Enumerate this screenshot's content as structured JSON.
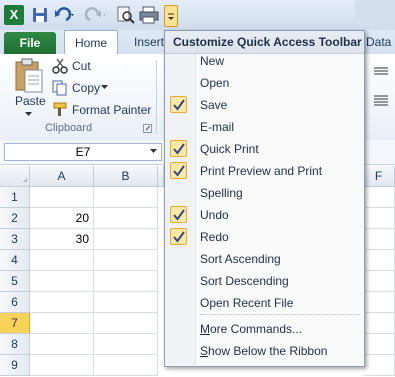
{
  "titlebar": {
    "excel_logo": "X"
  },
  "ribbon": {
    "tabs": [
      "File",
      "Home",
      "Insert",
      "Data"
    ],
    "clipboard": {
      "paste": "Paste",
      "cut": "Cut",
      "copy": "Copy",
      "format_painter": "Format Painter",
      "group_label": "Clipboard"
    }
  },
  "formula_bar": {
    "name_box": "E7"
  },
  "sheet": {
    "columns": [
      "A",
      "B",
      "F"
    ],
    "rows": [
      "1",
      "2",
      "3",
      "4",
      "5",
      "6",
      "7",
      "8",
      "9"
    ],
    "active_row": "7",
    "cells": {
      "a2": "20",
      "a3": "30"
    }
  },
  "menu": {
    "title": "Customize Quick Access Toolbar",
    "items": [
      {
        "label": "New",
        "checked": false
      },
      {
        "label": "Open",
        "checked": false
      },
      {
        "label": "Save",
        "checked": true
      },
      {
        "label": "E-mail",
        "checked": false
      },
      {
        "label": "Quick Print",
        "checked": true
      },
      {
        "label": "Print Preview and Print",
        "checked": true
      },
      {
        "label": "Spelling",
        "checked": false
      },
      {
        "label": "Undo",
        "checked": true
      },
      {
        "label": "Redo",
        "checked": true
      },
      {
        "label": "Sort Ascending",
        "checked": false
      },
      {
        "label": "Sort Descending",
        "checked": false
      },
      {
        "label": "Open Recent File",
        "checked": false
      }
    ],
    "more_commands": {
      "accel": "M",
      "rest": "ore Commands..."
    },
    "show_below": {
      "accel": "S",
      "rest": "how Below the Ribbon"
    }
  },
  "colors": {
    "accent_green": "#1e7b3a",
    "check_bg": "#fde8a6",
    "active_row": "#f9d25a"
  }
}
